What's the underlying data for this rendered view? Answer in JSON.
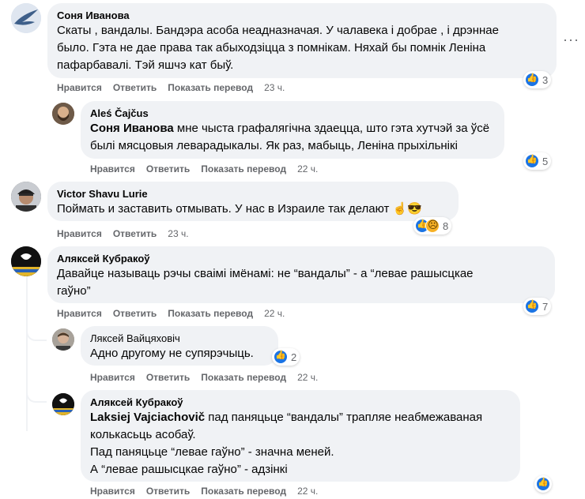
{
  "labels": {
    "like": "Нравится",
    "reply": "Ответить",
    "translate": "Показать перевод"
  },
  "comments": [
    {
      "author": "Соня Иванова",
      "lines": [
        "Скаты , вандалы. Бандэра асоба неадназначая. У чалавека і добрае , і дрэннае",
        "было. Гэта не дае права так абыходзіцца з помнікам. Няхай бы помнік Леніна",
        "пафарбавалі. Тэй яшчэ кат быў."
      ],
      "time": "23 ч.",
      "reactions": {
        "icons": [
          "like-icon"
        ],
        "count": "3"
      },
      "avatar": "bird-avatar"
    },
    {
      "author": "Aleś Čajčus",
      "mention": "Соня Иванова",
      "lines": [
        " мне чыста графалягічна здаецца, што гэта хутчэй за ўсё",
        "былі мясцовыя левaрадыкалы. Як раз, мабыць, Леніна прыхільнікі"
      ],
      "time": "22 ч.",
      "reactions": {
        "icons": [
          "like-icon"
        ],
        "count": "5"
      },
      "avatar": "bearded-man-avatar"
    },
    {
      "author": "Victor Shavu Lurie",
      "lines": [
        "Поймать и заставить отмывать. У нас в Израиле так делают ☝️😎"
      ],
      "time": "23 ч.",
      "reactions": {
        "icons": [
          "like-icon",
          "sad-icon"
        ],
        "count": "8"
      },
      "avatar": "cap-man-avatar"
    },
    {
      "author": "Аляксей Кубракоў",
      "lines": [
        "Давайце называць рэчы сваімі імёнамі: не “вандалы” - а “левае рашысцкае",
        "гаўно”"
      ],
      "time": "22 ч.",
      "reactions": {
        "icons": [
          "like-icon"
        ],
        "count": "7"
      },
      "avatar": "logo-avatar"
    },
    {
      "author": "Ляксей Вайцяховіч",
      "lines": [
        "Адно другому не супярэчыць."
      ],
      "time": "22 ч.",
      "reactions": {
        "icons": [
          "like-icon"
        ],
        "count": "2"
      },
      "avatar": "man-avatar"
    },
    {
      "author": "Аляксей Кубракоў",
      "mention": "Laksiej Vajciachovič",
      "lines": [
        " пад паняцьце “вандалы” трапляе неабмежаваная",
        "колькасьць асобаў.",
        "Пад паняцьце “левае гаўно” - значна меней.",
        "А “левае рашысцкае гаўно” - адзінкі"
      ],
      "time": "22 ч.",
      "reactions": {
        "icons": [
          "like-icon"
        ],
        "count": ""
      },
      "avatar": "logo-avatar"
    }
  ],
  "colors": {
    "like": "#1b74e4",
    "bubble": "#f0f2f5",
    "meta": "#65676b"
  }
}
